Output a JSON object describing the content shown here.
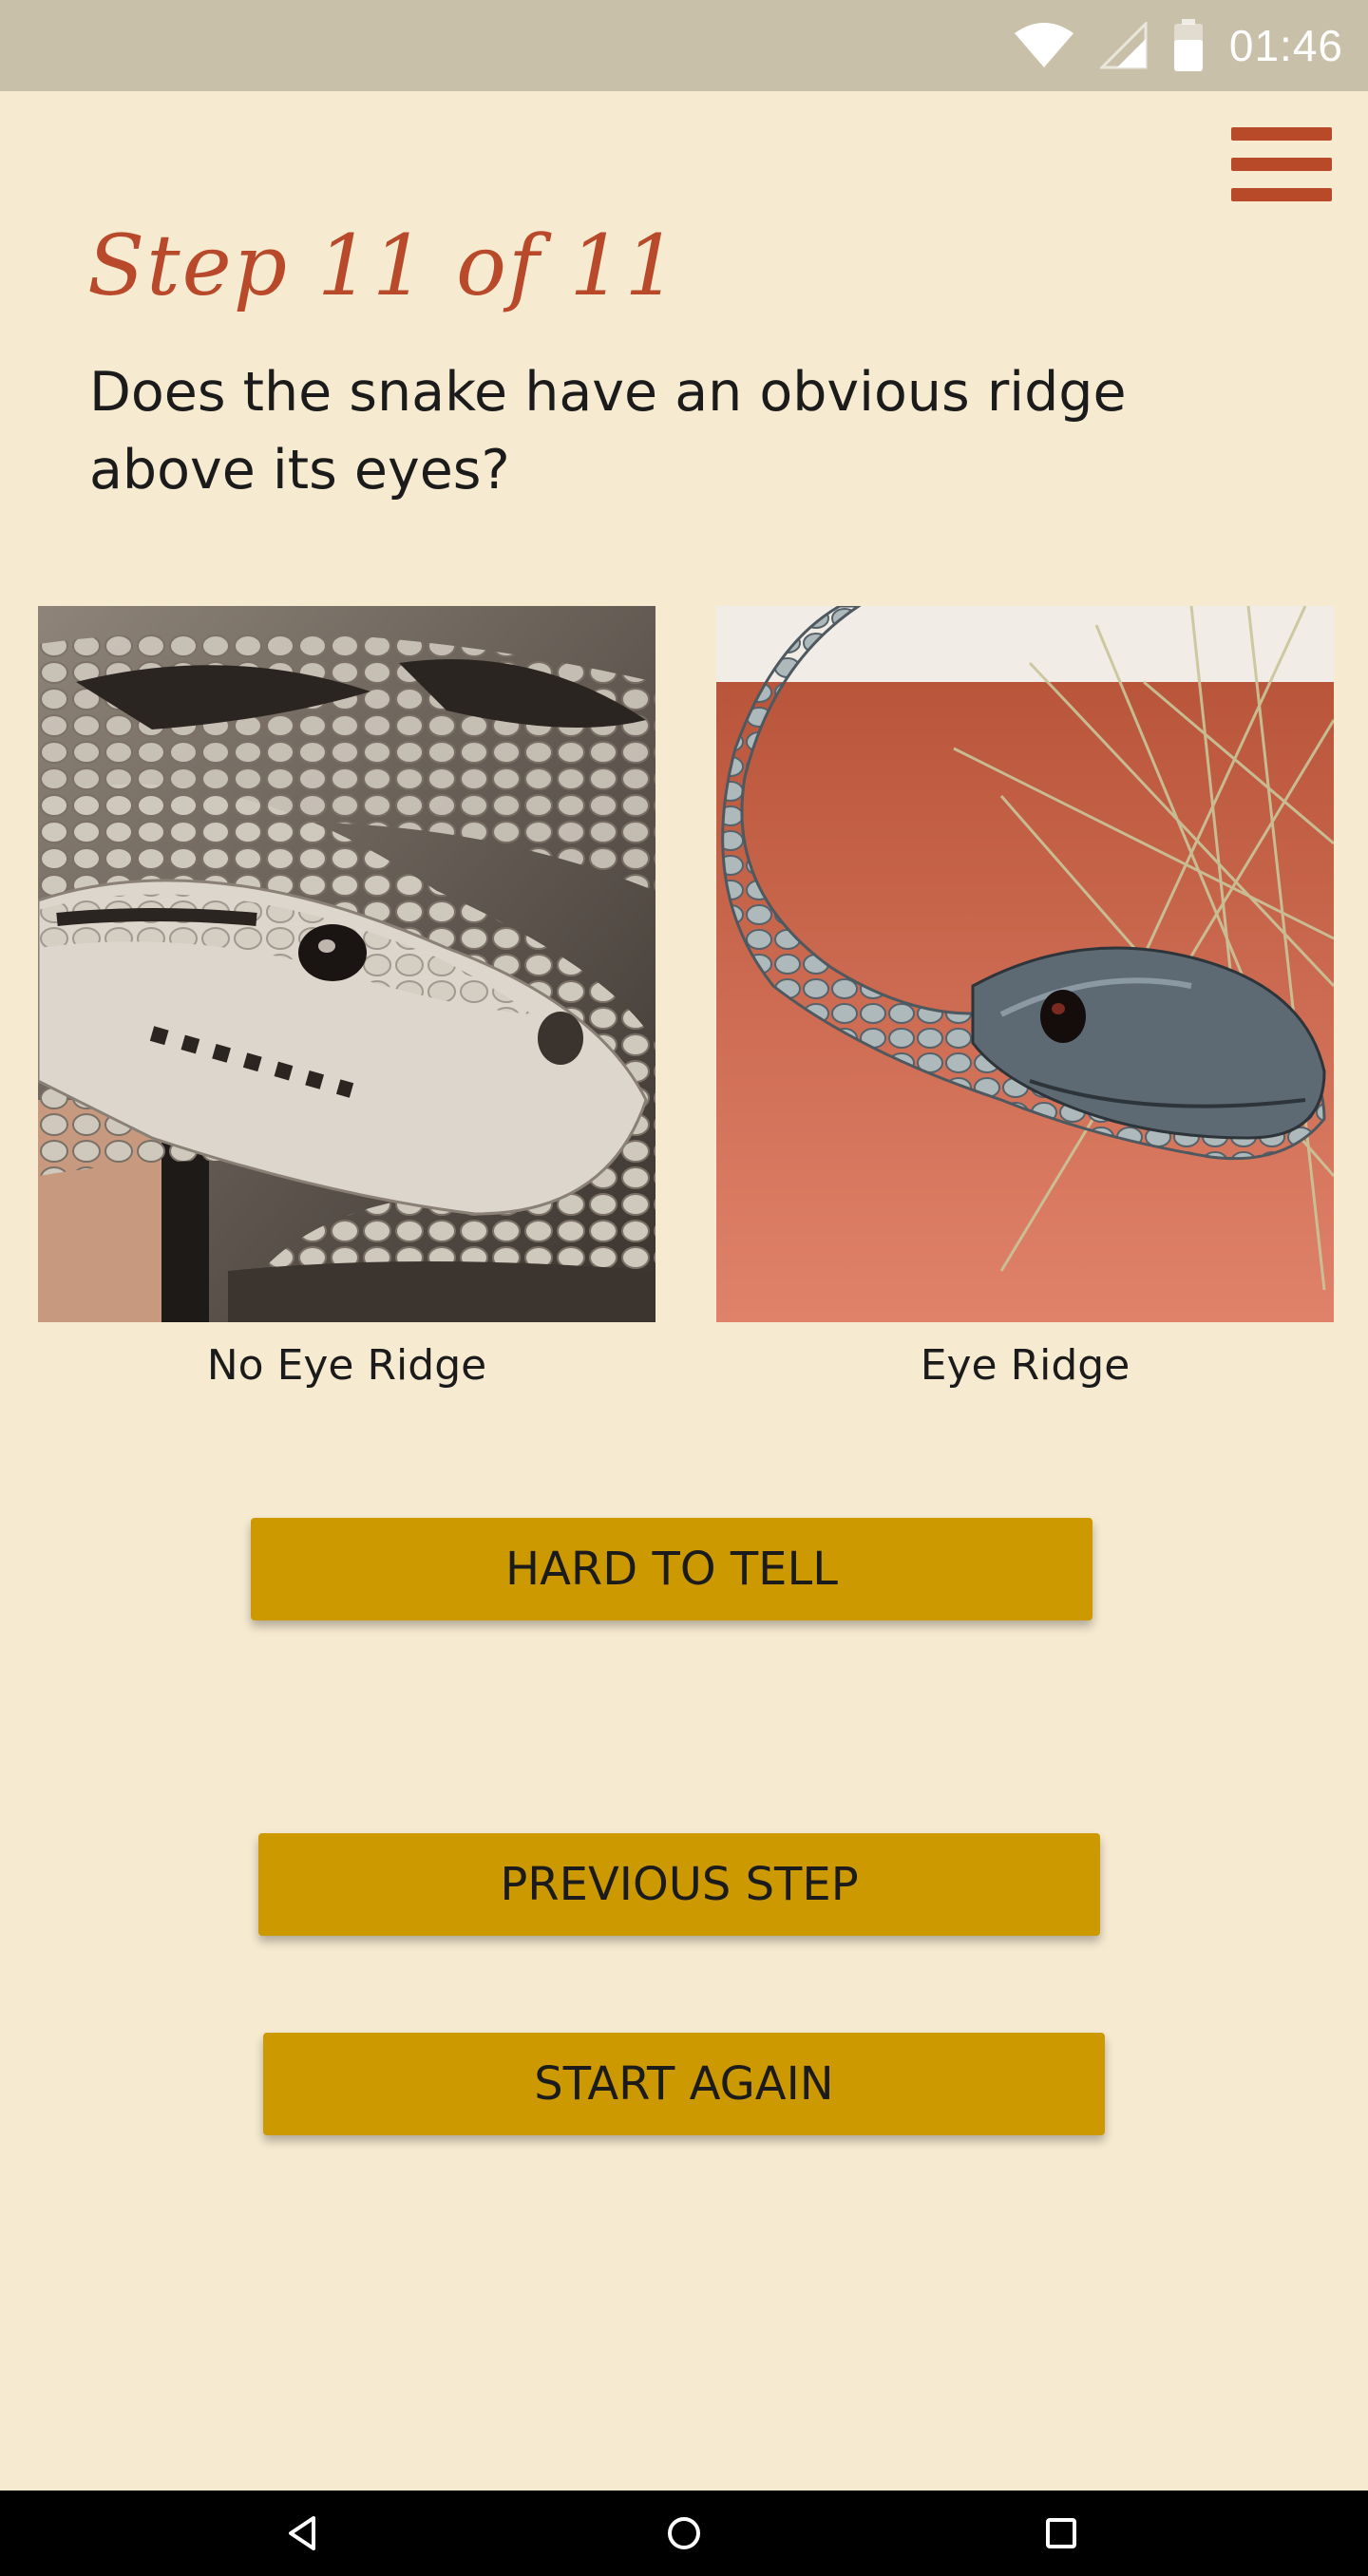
{
  "status_bar": {
    "time": "01:46",
    "icons": [
      "wifi-icon",
      "cell-signal-icon",
      "battery-icon"
    ]
  },
  "header": {
    "menu_icon": "hamburger-menu-icon"
  },
  "step": {
    "title": "Step 11 of 11",
    "question": "Does the snake have an obvious ridge above its eyes?"
  },
  "choices": [
    {
      "label": "No Eye Ridge",
      "image": "python-snake-photo"
    },
    {
      "label": "Eye Ridge",
      "image": "black-snake-photo"
    }
  ],
  "buttons": {
    "hard_to_tell": "HARD TO TELL",
    "previous_step": "PREVIOUS STEP",
    "start_again": "START AGAIN"
  },
  "colors": {
    "background": "#f6ead0",
    "accent": "#b8492a",
    "button": "#cc9900",
    "status_bar": "#c8c0a8"
  },
  "nav_bar": {
    "icons": [
      "back-icon",
      "home-icon",
      "recents-icon"
    ]
  }
}
